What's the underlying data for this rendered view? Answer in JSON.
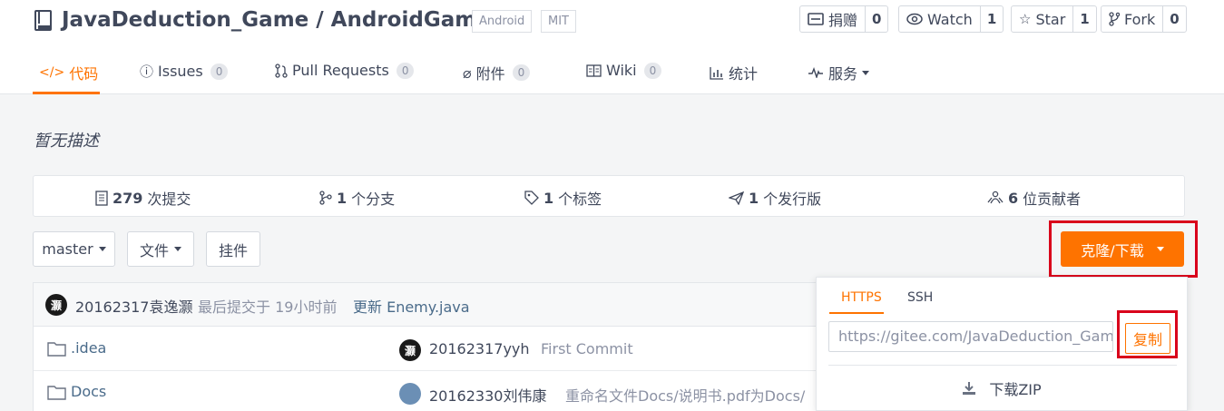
{
  "repo": {
    "title": "JavaDeduction_Game / AndroidGame",
    "tags": [
      "Android",
      "MIT"
    ]
  },
  "actions": [
    {
      "label": "捐赠",
      "count": "0",
      "icon": "donate-icon"
    },
    {
      "label": "Watch",
      "count": "1",
      "icon": "eye-icon"
    },
    {
      "label": "Star",
      "count": "1",
      "icon": "star-icon"
    },
    {
      "label": "Fork",
      "count": "0",
      "icon": "fork-icon"
    }
  ],
  "tabs": [
    {
      "label": "代码",
      "badge": "",
      "icon": "code-icon",
      "active": true
    },
    {
      "label": "Issues",
      "badge": "0",
      "icon": "issue-icon"
    },
    {
      "label": "Pull Requests",
      "badge": "0",
      "icon": "pull-request-icon"
    },
    {
      "label": "附件",
      "badge": "0",
      "icon": "attachment-icon"
    },
    {
      "label": "Wiki",
      "badge": "0",
      "icon": "wiki-icon"
    },
    {
      "label": "统计",
      "badge": "",
      "icon": "stats-icon"
    },
    {
      "label": "服务",
      "badge": "",
      "icon": "pulse-icon"
    }
  ],
  "description": "暂无描述",
  "stats": [
    {
      "num": "279",
      "label": "次提交",
      "icon": "commit-icon"
    },
    {
      "num": "1",
      "label": "个分支",
      "icon": "branch-icon"
    },
    {
      "num": "1",
      "label": "个标签",
      "icon": "tag-icon"
    },
    {
      "num": "1",
      "label": "个发行版",
      "icon": "release-icon"
    },
    {
      "num": "6",
      "label": "位贡献者",
      "icon": "contributors-icon"
    }
  ],
  "toolbar": {
    "branch": "master",
    "file": "文件",
    "widget": "挂件",
    "clone": "克隆/下载"
  },
  "last_commit": {
    "avatar_char": "灏",
    "author": "20162317袁逸灏",
    "meta": "最后提交于 19小时前",
    "message": "更新 Enemy.java"
  },
  "files": [
    {
      "name": ".idea",
      "avatar_char": "灏",
      "author": "20162317yyh",
      "message": "First Commit"
    },
    {
      "name": "Docs",
      "avatar_char": "",
      "author": "20162330刘伟康",
      "message": "重命名文件Docs/说明书.pdf为Docs/"
    }
  ],
  "clone_panel": {
    "tabs": [
      "HTTPS",
      "SSH"
    ],
    "url": "https://gitee.com/JavaDeduction_Game",
    "copy": "复制",
    "zip": "下载ZIP"
  },
  "colors": {
    "accent": "#fe7300",
    "highlight": "#d9001b",
    "link": "#4a6b8a"
  }
}
